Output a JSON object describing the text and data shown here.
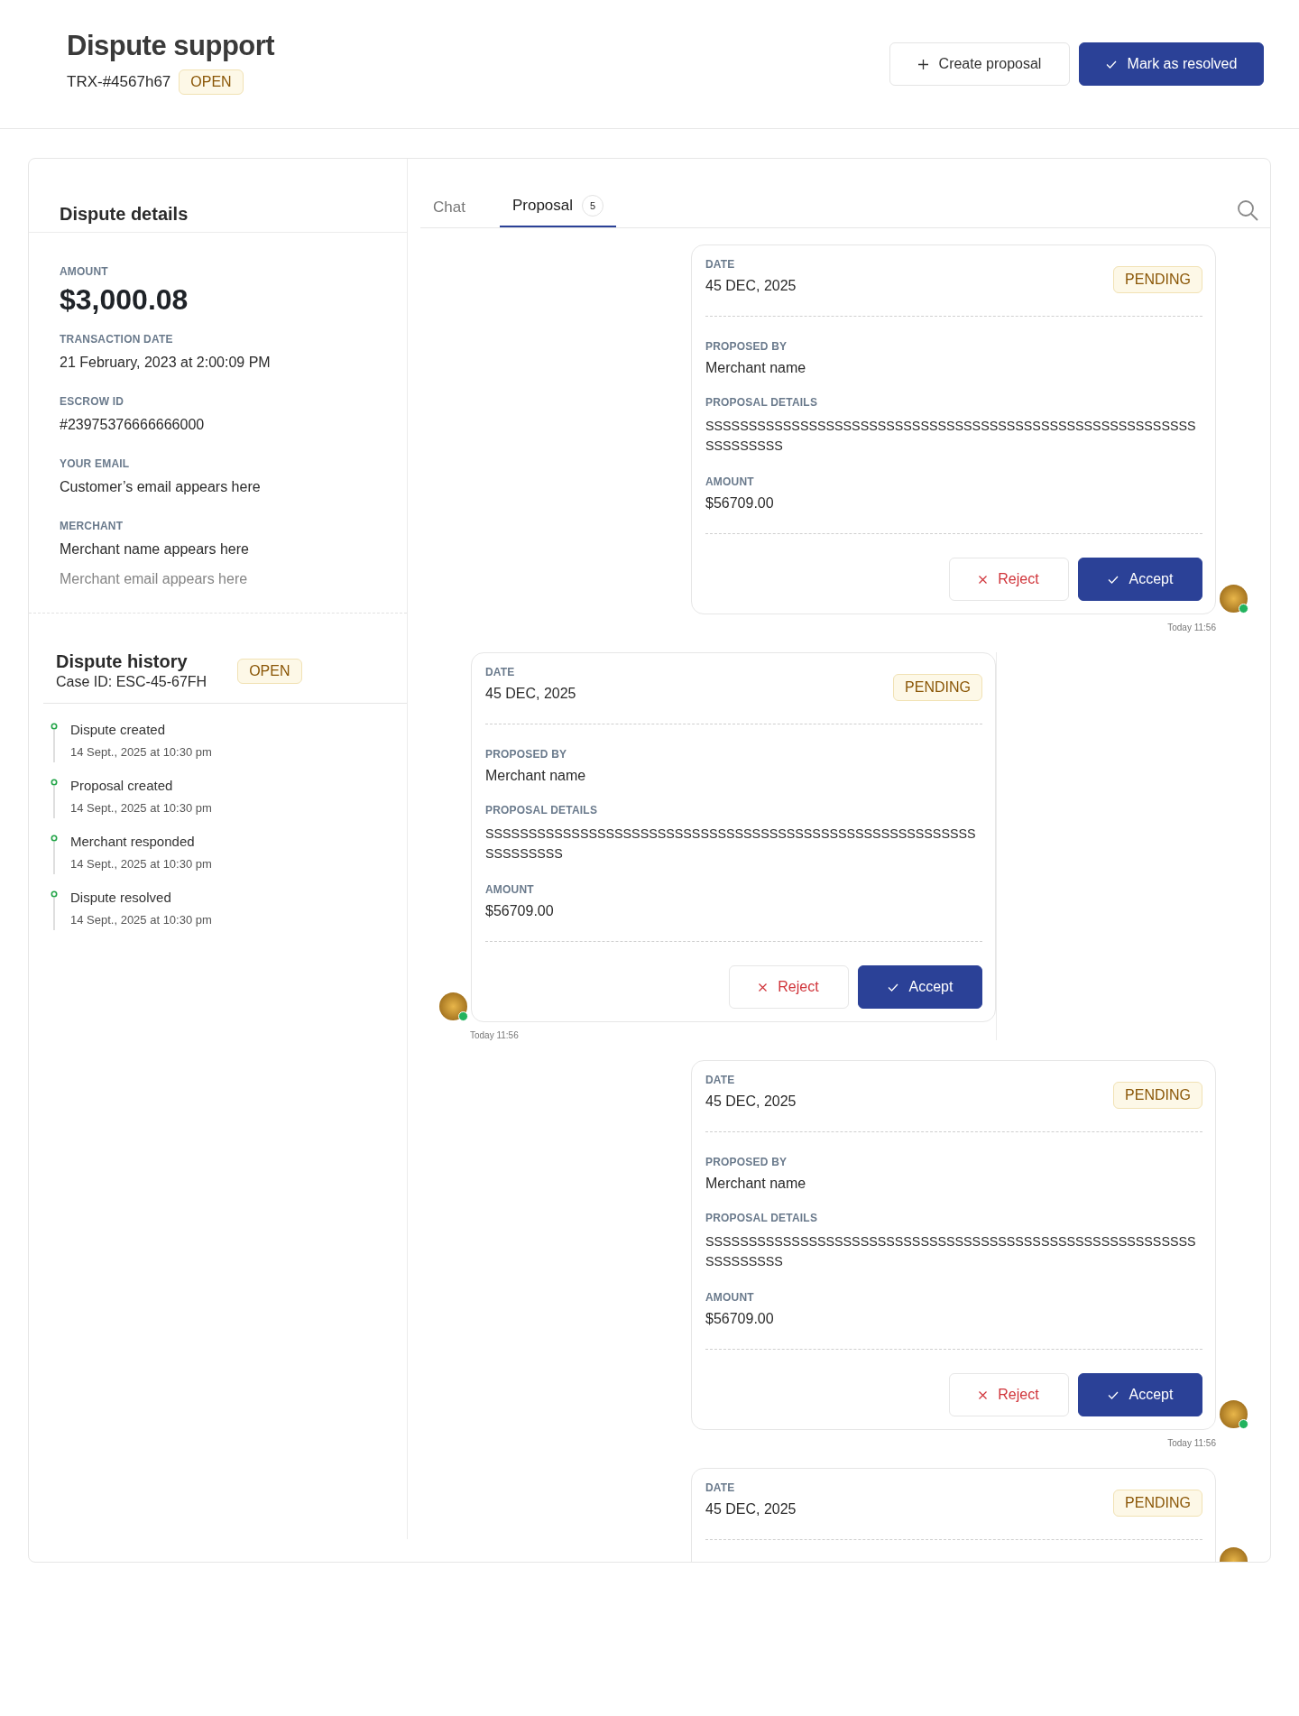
{
  "header": {
    "title": "Dispute support",
    "reference": "TRX-#4567h67",
    "status": "OPEN",
    "buttons": [
      {
        "kind": "secondary",
        "label": "Create proposal"
      },
      {
        "kind": "primary",
        "label": "Mark as resolved"
      }
    ]
  },
  "details": {
    "title": "Dispute details",
    "amount_label": "AMOUNT",
    "amount": "$3,000.08",
    "fields": [
      {
        "label": "TRANSACTION DATE",
        "value": "21 February, 2023 at 2:00:09 PM"
      },
      {
        "label": "ESCROW ID",
        "value": "#23975376666666000"
      },
      {
        "label": "YOUR EMAIL",
        "value": "Customer’s email appears here"
      },
      {
        "label": "MERCHANT",
        "value": "Merchant name appears here",
        "secondary": "Merchant email appears here"
      }
    ]
  },
  "history": {
    "title": "Dispute history",
    "case_id": "Case ID: ESC-45-67FH",
    "status": "OPEN",
    "events": [
      {
        "title": "Dispute created",
        "time": "14 Sept., 2025 at 10:30 pm"
      },
      {
        "title": "Proposal created",
        "time": "14 Sept., 2025 at 10:30 pm"
      },
      {
        "title": "Merchant responded",
        "time": "14 Sept., 2025 at 10:30 pm"
      },
      {
        "title": "Dispute resolved",
        "time": "14 Sept., 2025 at 10:30 pm"
      }
    ]
  },
  "tabs": [
    {
      "label": "Chat",
      "selected": false
    },
    {
      "label": "Proposal",
      "selected": true,
      "count": "5"
    }
  ],
  "proposals": [
    {
      "kind": "outgoing",
      "online": true,
      "date_label": "DATE",
      "date": "45 DEC, 2025",
      "status": "PENDING",
      "proposed_by_label": "PROPOSED BY",
      "proposed_by": "Merchant name",
      "details_label": "PROPOSAL DETAILS",
      "details": "SSSSSSSSSSSSSSSSSSSSSSSSSSSSSSSSSSSSSSSSSSSSSSSSSSSSSSSSSSSSSSSSSS",
      "amount_label": "AMOUNT",
      "amount": "$56709.00",
      "reject": "Reject",
      "accept": "Accept",
      "time": "Today 11:56"
    },
    {
      "kind": "incoming",
      "online": true,
      "date_label": "DATE",
      "date": "45 DEC, 2025",
      "status": "PENDING",
      "proposed_by_label": "PROPOSED BY",
      "proposed_by": "Merchant name",
      "details_label": "PROPOSAL DETAILS",
      "details": "SSSSSSSSSSSSSSSSSSSSSSSSSSSSSSSSSSSSSSSSSSSSSSSSSSSSSSSSSSSSSSSSSS",
      "amount_label": "AMOUNT",
      "amount": "$56709.00",
      "reject": "Reject",
      "accept": "Accept",
      "time": "Today 11:56"
    },
    {
      "kind": "outgoing",
      "online": true,
      "date_label": "DATE",
      "date": "45 DEC, 2025",
      "status": "PENDING",
      "proposed_by_label": "PROPOSED BY",
      "proposed_by": "Merchant name",
      "details_label": "PROPOSAL DETAILS",
      "details": "SSSSSSSSSSSSSSSSSSSSSSSSSSSSSSSSSSSSSSSSSSSSSSSSSSSSSSSSSSSSSSSSSS",
      "amount_label": "AMOUNT",
      "amount": "$56709.00",
      "reject": "Reject",
      "accept": "Accept",
      "time": "Today 11:56"
    },
    {
      "kind": "outgoing",
      "date_label": "DATE",
      "date": "45 DEC, 2025",
      "status": "PENDING"
    }
  ]
}
